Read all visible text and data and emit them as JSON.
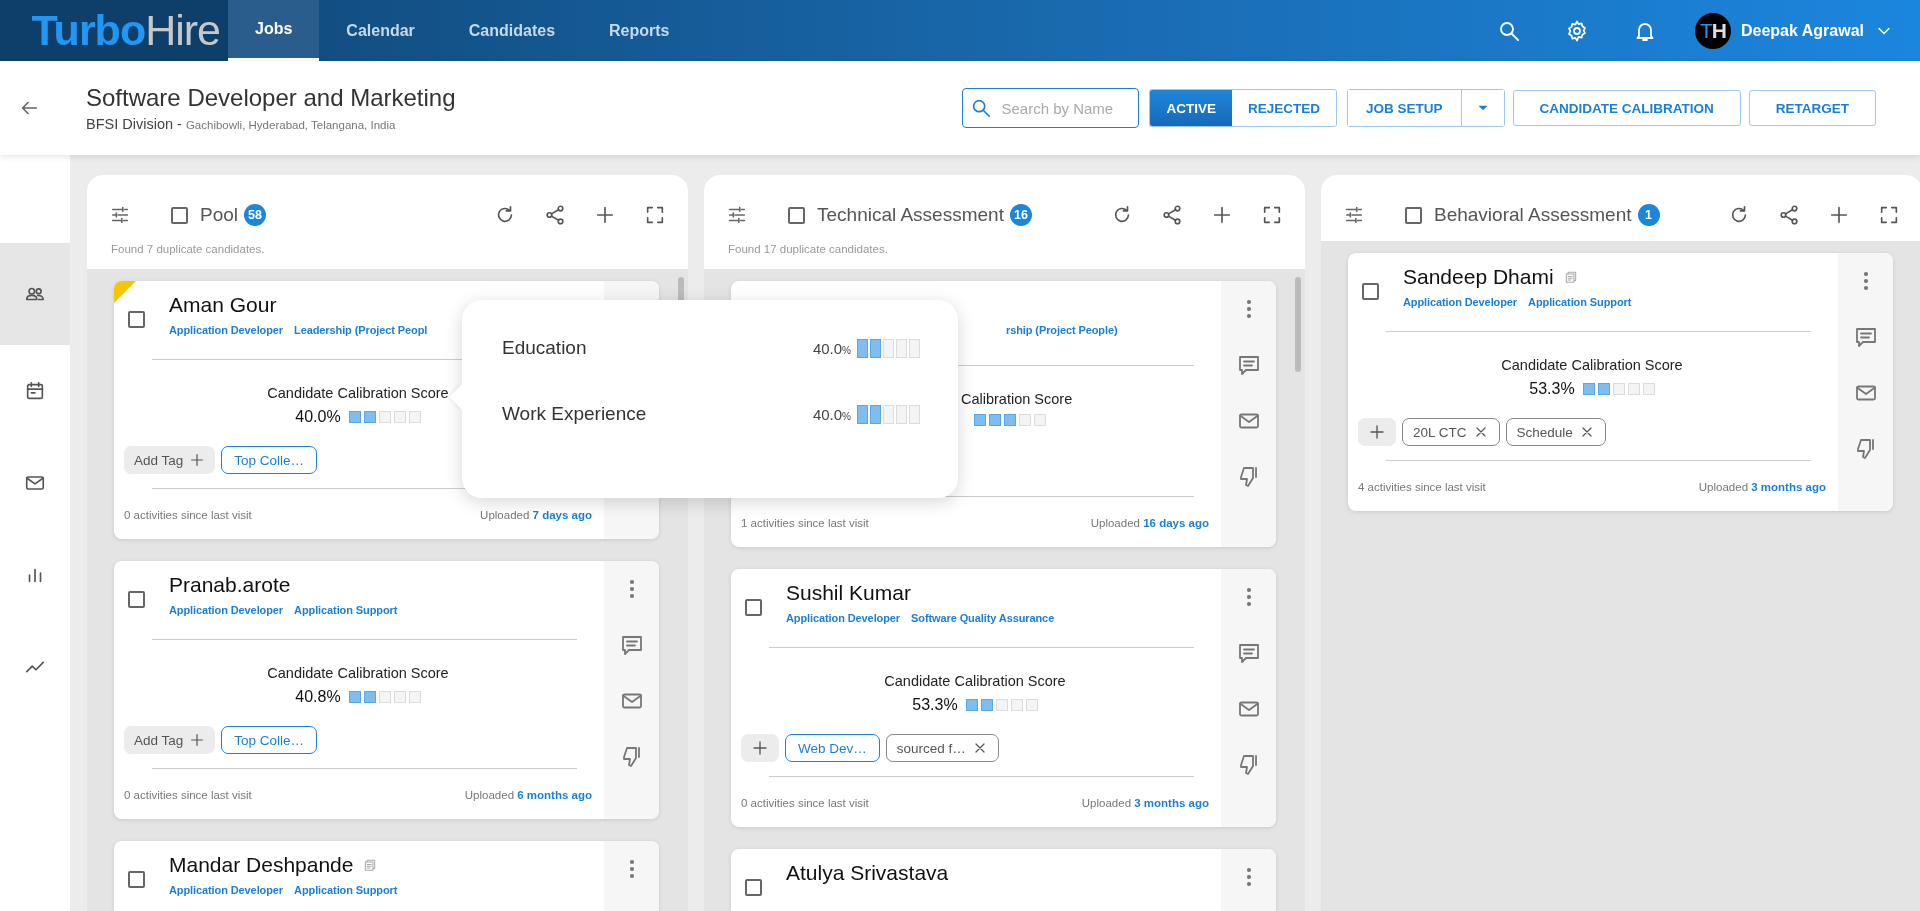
{
  "app": {
    "logo_primary": "Turbo",
    "logo_secondary": "Hire"
  },
  "nav": {
    "tabs": [
      {
        "label": "Jobs",
        "selected": true
      },
      {
        "label": "Calendar",
        "selected": false
      },
      {
        "label": "Candidates",
        "selected": false
      },
      {
        "label": "Reports",
        "selected": false
      }
    ],
    "user": {
      "initials_primary": "T",
      "initials_secondary": "H",
      "name": "Deepak Agrawal"
    }
  },
  "job": {
    "title": "Software Developer and Marketing",
    "division": "BFSI Division -",
    "location": "Gachibowli, Hyderabad, Telangana, India"
  },
  "search": {
    "placeholder": "Search by Name"
  },
  "status_toggle": [
    {
      "label": "ACTIVE",
      "selected": true
    },
    {
      "label": "REJECTED",
      "selected": false
    }
  ],
  "actions": [
    {
      "label": "JOB SETUP",
      "kind": "split"
    },
    {
      "label": "CANDIDATE CALIBRATION",
      "kind": "plain"
    },
    {
      "label": "RETARGET",
      "kind": "plain"
    }
  ],
  "sidebar": {
    "items": [
      {
        "kind": "people",
        "selected": true
      },
      {
        "kind": "calendar",
        "selected": false
      },
      {
        "kind": "mail",
        "selected": false
      },
      {
        "kind": "chart",
        "selected": false
      },
      {
        "kind": "trend",
        "selected": false
      }
    ]
  },
  "columns": [
    {
      "title": "Pool",
      "count": "58",
      "checked": false,
      "note": "Found 7 duplicate candidates.",
      "cards": [
        {
          "name": "Aman Gour",
          "flagged": true,
          "duplicate": false,
          "checked": false,
          "covered": false,
          "actions_hidden": true,
          "tags": [
            "Application Developer",
            "Leadership (Project Peopl"
          ],
          "score_label": "Candidate Calibration Score",
          "score": "40.0%",
          "stars": 2,
          "chips": [
            {
              "kind": "add",
              "label": "Add Tag"
            },
            {
              "kind": "outlined",
              "label": "Top Colle…"
            }
          ],
          "activity": "0 activities since last visit",
          "uploaded": "Uploaded",
          "uploaded_when": "7 days ago"
        },
        {
          "name": "Pranab.arote",
          "flagged": false,
          "duplicate": false,
          "checked": false,
          "covered": false,
          "actions_hidden": false,
          "tags": [
            "Application Developer",
            "Application Support"
          ],
          "score_label": "Candidate Calibration Score",
          "score": "40.8%",
          "stars": 2,
          "chips": [
            {
              "kind": "add",
              "label": "Add Tag"
            },
            {
              "kind": "outlined",
              "label": "Top Colle…"
            }
          ],
          "activity": "0 activities since last visit",
          "uploaded": "Uploaded",
          "uploaded_when": "6 months ago"
        },
        {
          "name": "Mandar Deshpande",
          "flagged": false,
          "duplicate": true,
          "checked": false,
          "covered": false,
          "actions_hidden": false,
          "tags": [
            "Application Developer",
            "Application Support"
          ]
        }
      ]
    },
    {
      "title": "Technical Assessment",
      "count": "16",
      "checked": false,
      "note": "Found 17 duplicate candidates.",
      "cards": [
        {
          "flagged": false,
          "duplicate": false,
          "covered": true,
          "actions_hidden": false,
          "tags": [
            "rship (Project People)"
          ],
          "score_label": "Calibration Score",
          "stars": 3,
          "activity": "1 activities since last visit",
          "uploaded": "Uploaded",
          "uploaded_when": "16 days ago"
        },
        {
          "name": "Sushil Kumar",
          "flagged": false,
          "duplicate": false,
          "checked": false,
          "covered": false,
          "actions_hidden": false,
          "tags": [
            "Application Developer",
            "Software Quality Assurance"
          ],
          "score_label": "Candidate Calibration Score",
          "score": "53.3%",
          "stars": 2,
          "chips": [
            {
              "kind": "plus"
            },
            {
              "kind": "outlined",
              "label": "Web Dev…"
            },
            {
              "kind": "removable",
              "label": "sourced f…"
            }
          ],
          "activity": "0 activities since last visit",
          "uploaded": "Uploaded",
          "uploaded_when": "3 months ago"
        },
        {
          "name": "Atulya Srivastava",
          "flagged": false,
          "duplicate": false,
          "checked": false,
          "actions_hidden": false
        }
      ]
    },
    {
      "title": "Behavioral Assessment",
      "count": "1",
      "checked": false,
      "cards": [
        {
          "name": "Sandeep Dhami",
          "flagged": false,
          "duplicate": true,
          "checked": false,
          "covered": false,
          "actions_hidden": false,
          "tags": [
            "Application Developer",
            "Application Support"
          ],
          "score_label": "Candidate Calibration Score",
          "score": "53.3%",
          "stars": 2,
          "chips": [
            {
              "kind": "plus"
            },
            {
              "kind": "removable",
              "label": "20L CTC"
            },
            {
              "kind": "removable",
              "label": "Schedule"
            }
          ],
          "activity": "4 activities since last visit",
          "uploaded": "Uploaded",
          "uploaded_when": "3 months ago"
        }
      ]
    }
  ],
  "popover": {
    "rows": [
      {
        "label": "Education",
        "score": "40.0",
        "unit": "%",
        "stars": 2
      },
      {
        "label": "Work Experience",
        "score": "40.0",
        "unit": "%",
        "stars": 2
      }
    ]
  }
}
